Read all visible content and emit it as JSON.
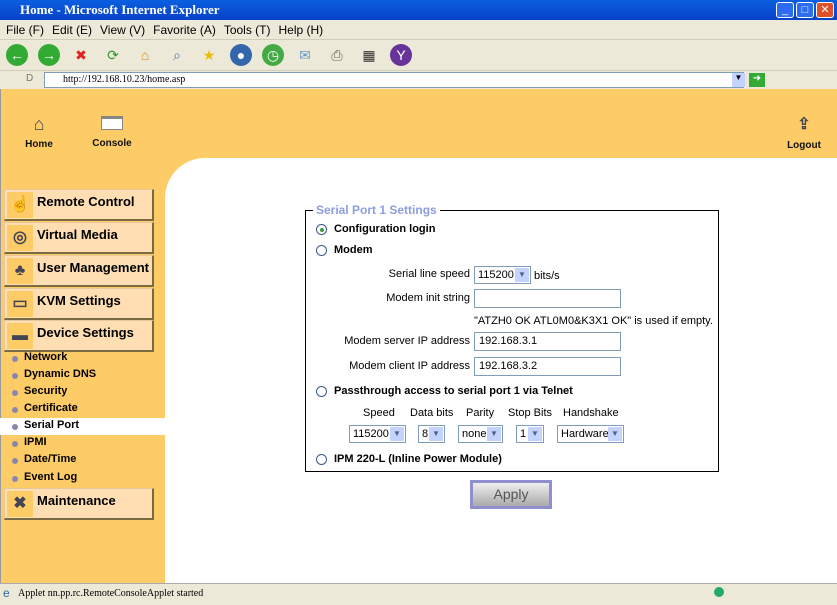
{
  "window": {
    "title": "Home - Microsoft Internet Explorer"
  },
  "menu": [
    "File (F)",
    "Edit (E)",
    "View (V)",
    "Favorite (A)",
    "Tools (T)",
    "Help (H)"
  ],
  "address": {
    "label": "D",
    "url": "http://192.168.10.23/home.asp"
  },
  "top": {
    "home": "Home",
    "console": "Console",
    "logout": "Logout"
  },
  "nav": {
    "remote": "Remote Control",
    "virtual": "Virtual Media",
    "user": "User Management",
    "kvm": "KVM Settings",
    "device": "Device Settings",
    "maintenance": "Maintenance",
    "sub": [
      "Network",
      "Dynamic DNS",
      "Security",
      "Certificate",
      "Serial Port",
      "IPMI",
      "Date/Time",
      "Event Log"
    ]
  },
  "form": {
    "legend": "Serial Port 1 Settings",
    "config_login": "Configuration login",
    "modem": "Modem",
    "speed_label": "Serial line speed",
    "speed_value": "115200",
    "speed_unit": "bits/s",
    "init_label": "Modem init string",
    "init_value": "",
    "init_hint": "\"ATZH0 OK ATL0M0&K3X1 OK\" is used if empty.",
    "server_label": "Modem server IP address",
    "server_value": "192.168.3.1",
    "client_label": "Modem client IP address",
    "client_value": "192.168.3.2",
    "passthrough": "Passthrough access to serial port 1 via Telnet",
    "cols": {
      "speed": "Speed",
      "data": "Data bits",
      "parity": "Parity",
      "stop": "Stop Bits",
      "hand": "Handshake"
    },
    "vals": {
      "speed": "115200",
      "data": "8",
      "parity": "none",
      "stop": "1",
      "hand": "Hardware"
    },
    "ipm": "IPM 220-L (Inline Power Module)",
    "apply": "Apply",
    "selected": "Configuration login"
  },
  "status": "Applet nn.pp.rc.RemoteConsoleApplet started"
}
